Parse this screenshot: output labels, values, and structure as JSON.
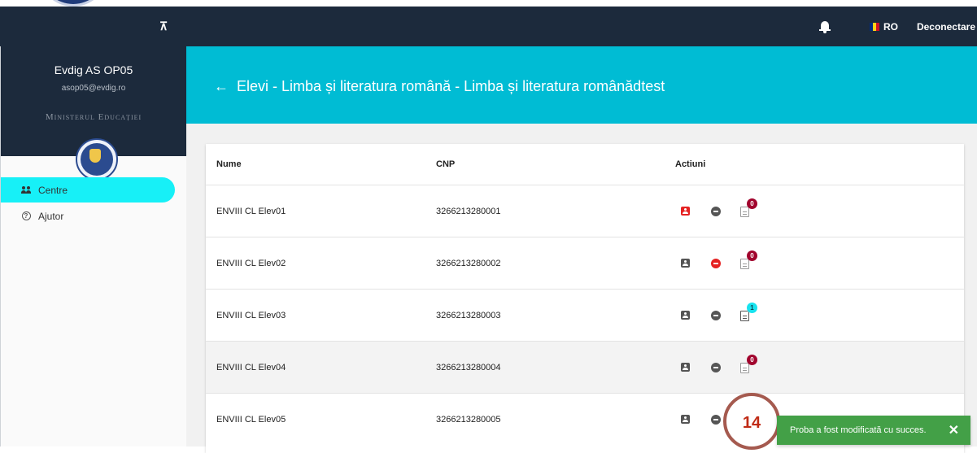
{
  "topbar": {
    "language": "RO",
    "logout_label": "Deconectare",
    "flag_colors": [
      "#002b7f",
      "#fcd116",
      "#ce1126"
    ]
  },
  "sidebar": {
    "user_name": "Evdig AS OP05",
    "user_email": "asop05@evdig.ro",
    "ministry": "Ministerul Educației",
    "items": [
      {
        "label": "Centre",
        "icon": "people-icon",
        "active": true
      },
      {
        "label": "Ajutor",
        "icon": "help-circle-icon",
        "active": false
      }
    ]
  },
  "page": {
    "title": "Elevi - Limba și literatura română - Limba și literatura românădtest"
  },
  "table": {
    "columns": [
      "Nume",
      "CNP",
      "Actiuni"
    ],
    "rows": [
      {
        "name": "ENVIII CL Elev01",
        "cnp": "3266213280001",
        "badge": "0"
      },
      {
        "name": "ENVIII CL Elev02",
        "cnp": "3266213280002",
        "badge": "0"
      },
      {
        "name": "ENVIII CL Elev03",
        "cnp": "3266213280003",
        "badge": "1"
      },
      {
        "name": "ENVIII CL Elev04",
        "cnp": "3266213280004",
        "badge": "0"
      },
      {
        "name": "ENVIII CL Elev05",
        "cnp": "3266213280005",
        "badge": ""
      }
    ]
  },
  "step_marker": "14",
  "toast": {
    "message": "Proba a fost modificată cu succes.",
    "close": "✕"
  },
  "colors": {
    "header": "#1c2a3c",
    "banner": "#00bcd4",
    "active_nav": "#17f0f7",
    "danger": "#e52222",
    "badge_red": "#a1042d",
    "badge_cyan": "#17e3ef",
    "toast": "#43a047"
  }
}
